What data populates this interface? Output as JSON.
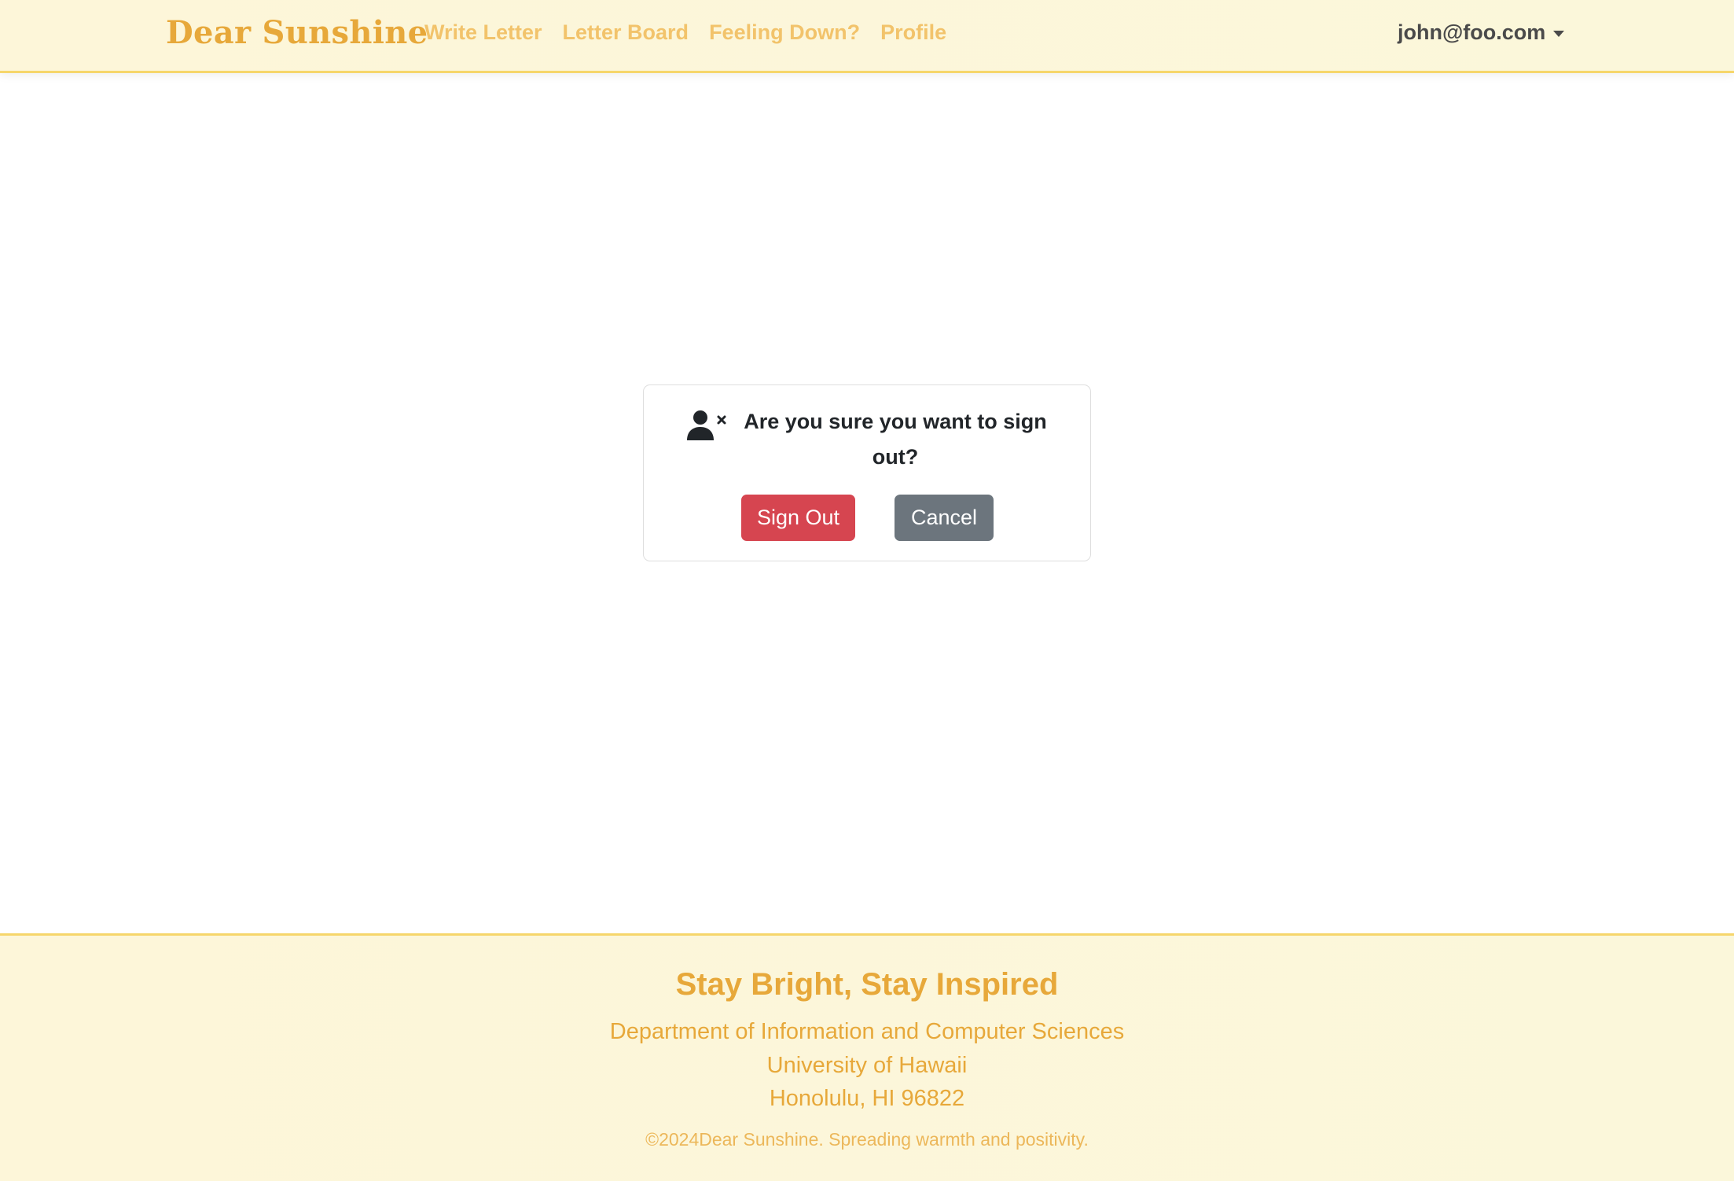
{
  "navbar": {
    "brand": "Dear Sunshine",
    "links": [
      "Write Letter",
      "Letter Board",
      "Feeling Down?",
      "Profile"
    ],
    "user_email": "john@foo.com"
  },
  "dialog": {
    "icon": "user-x-icon",
    "title": "Are you sure you want to sign out?",
    "confirm_label": "Sign Out",
    "cancel_label": "Cancel"
  },
  "footer": {
    "title": "Stay Bright, Stay Inspired",
    "lines": [
      "Department of Information and Computer Sciences",
      "University of Hawaii",
      "Honolulu, HI 96822"
    ],
    "copyright": "©2024Dear Sunshine. Spreading warmth and positivity."
  },
  "colors": {
    "brand": "#e7a83a",
    "nav_link": "#f2c36b",
    "danger": "#d64550",
    "secondary": "#6c757d",
    "header_bg": "#fdf6d9"
  }
}
